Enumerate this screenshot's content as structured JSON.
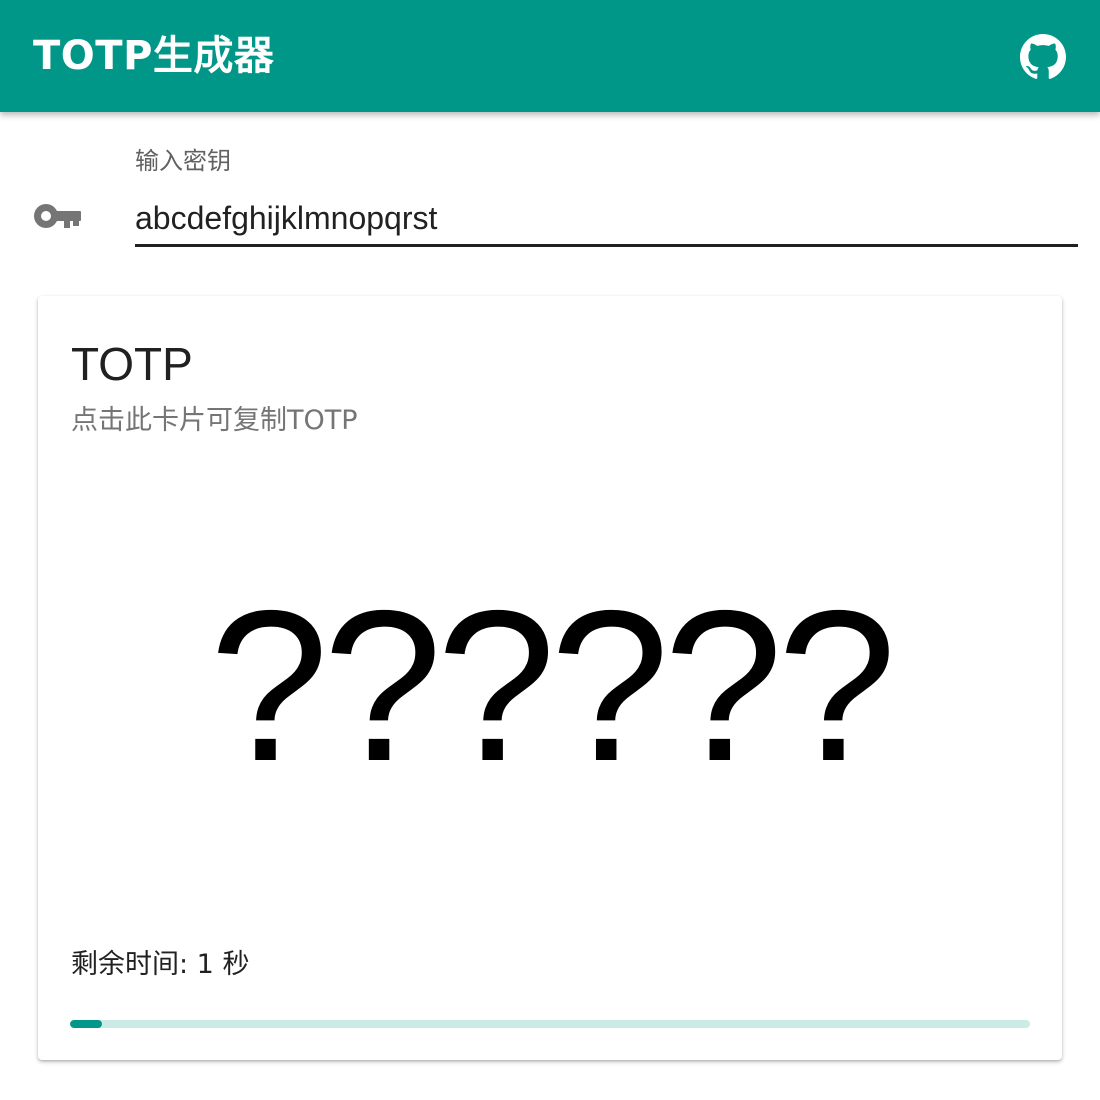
{
  "app_bar": {
    "title": "TOTP生成器",
    "github_icon": "github-icon",
    "color": "#009688"
  },
  "secret_field": {
    "icon": "key-icon",
    "label": "输入密钥",
    "value": "abcdefghijklmnopqrst"
  },
  "totp_card": {
    "title": "TOTP",
    "subtitle": "点击此卡片可复制TOTP",
    "code": "??????",
    "remaining_text": "剩余时间: 1 秒",
    "progress_fraction": 0.0333,
    "progress_color": "#009688",
    "progress_track_color": "#cceae6"
  }
}
